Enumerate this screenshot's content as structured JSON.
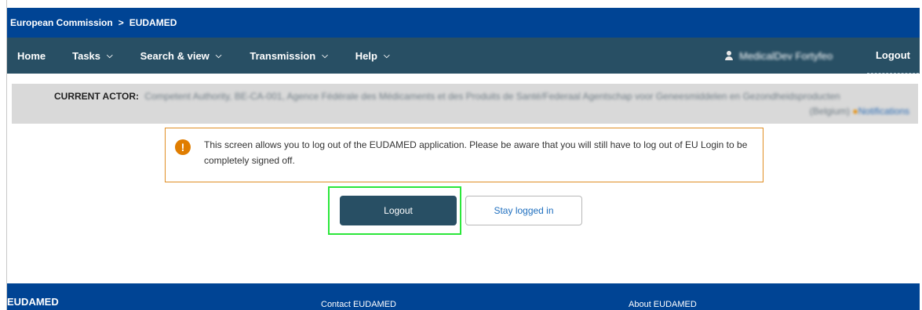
{
  "breadcrumb": {
    "parent": "European Commission",
    "separator": ">",
    "current": "EUDAMED"
  },
  "nav": {
    "items": [
      {
        "label": "Home",
        "has_dropdown": false
      },
      {
        "label": "Tasks",
        "has_dropdown": true
      },
      {
        "label": "Search & view",
        "has_dropdown": true
      },
      {
        "label": "Transmission",
        "has_dropdown": true
      },
      {
        "label": "Help",
        "has_dropdown": true
      }
    ],
    "dropdown_glyph": "⌵",
    "user_name": "MedicalDev Fortyfeo",
    "logout_label": "Logout"
  },
  "actor": {
    "label": "CURRENT ACTOR:",
    "name": "Competent Authority, BE-CA-001, Agence Fédérale des Médicaments et des Produits de Santé/Federaal Agentschap voor Geneesmiddelen en Gezondheidsproducten",
    "country": "(Belgium)",
    "notifications_label": "Notifications",
    "notifications_glyph": "●"
  },
  "notice": {
    "icon": "warning-icon",
    "icon_glyph": "!",
    "text": "This screen allows you to log out of the EUDAMED application. Please be aware that you will still have to log out of EU Login to be completely signed off."
  },
  "actions": {
    "logout_label": "Logout",
    "stay_label": "Stay logged in"
  },
  "footer": {
    "brand": "EUDAMED",
    "contact": "Contact EUDAMED",
    "about": "About EUDAMED"
  },
  "colors": {
    "top_bar": "#004494",
    "nav_bar": "#284f64",
    "warning": "#e07d00",
    "highlight": "#2be73a",
    "link": "#1f6fbf"
  }
}
